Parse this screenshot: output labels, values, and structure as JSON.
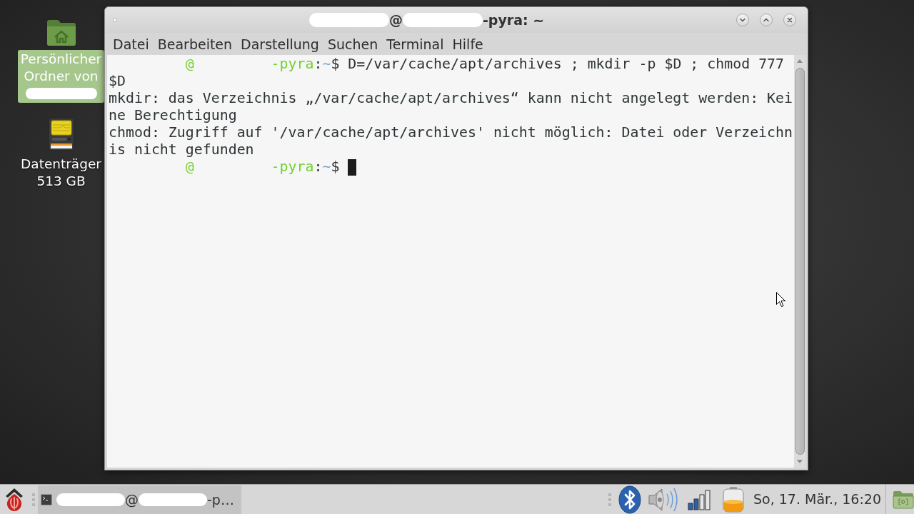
{
  "desktop_icons": [
    {
      "kind": "home-folder",
      "label_lines": [
        "Persönlicher",
        "Ordner von"
      ],
      "redacted_line": true,
      "selected": true
    },
    {
      "kind": "drive",
      "label_lines": [
        "Datenträger",
        "513 GB"
      ],
      "redacted_line": false,
      "selected": false
    }
  ],
  "terminal_window": {
    "title_segments": [
      {
        "kind": "redacted"
      },
      {
        "kind": "text",
        "text": "@"
      },
      {
        "kind": "redacted"
      },
      {
        "kind": "text",
        "text": "-pyra: ~"
      }
    ],
    "menu": [
      "Datei",
      "Bearbeiten",
      "Darstellung",
      "Suchen",
      "Terminal",
      "Hilfe"
    ],
    "rows": [
      {
        "kind": "prompt",
        "segments": [
          {
            "kind": "redacted"
          },
          {
            "kind": "host",
            "text": "@"
          },
          {
            "kind": "redacted"
          },
          {
            "kind": "host",
            "text": "-pyra"
          },
          {
            "kind": "plain",
            "text": ":"
          },
          {
            "kind": "path",
            "text": "~"
          },
          {
            "kind": "plain",
            "text": "$"
          }
        ],
        "command": "D=/var/cache/apt/archives ; mkdir -p $D ; chmod 777",
        "cursor": false
      },
      {
        "kind": "output",
        "text": "$D",
        "cursor": false
      },
      {
        "kind": "output",
        "text": "mkdir: das Verzeichnis „/var/cache/apt/archives“ kann nicht angelegt werden: Kei",
        "cursor": false
      },
      {
        "kind": "output",
        "text": "ne Berechtigung",
        "cursor": false
      },
      {
        "kind": "output",
        "text": "chmod: Zugriff auf '/var/cache/apt/archives' nicht möglich: Datei oder Verzeichn",
        "cursor": false
      },
      {
        "kind": "output",
        "text": "is nicht gefunden",
        "cursor": false
      },
      {
        "kind": "prompt",
        "segments": [
          {
            "kind": "redacted"
          },
          {
            "kind": "host",
            "text": "@"
          },
          {
            "kind": "redacted"
          },
          {
            "kind": "host",
            "text": "-pyra"
          },
          {
            "kind": "plain",
            "text": ":"
          },
          {
            "kind": "path",
            "text": "~"
          },
          {
            "kind": "plain",
            "text": "$"
          }
        ],
        "cursor": true
      }
    ]
  },
  "taskbar": {
    "tasks": [
      {
        "segments": [
          {
            "kind": "redacted"
          },
          {
            "kind": "text",
            "text": "@"
          },
          {
            "kind": "redacted"
          },
          {
            "kind": "text",
            "text": "-p…"
          }
        ],
        "selected": true
      }
    ],
    "clock": "So, 17. Mär., 16:20"
  }
}
